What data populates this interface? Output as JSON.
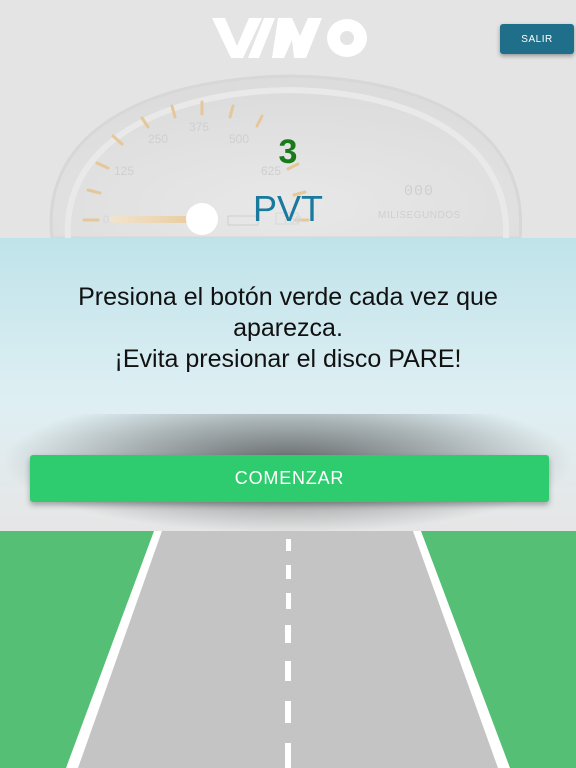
{
  "header": {
    "logo_text": "VIMO",
    "exit_label": "SALIR",
    "count": "3",
    "app_name": "PVT"
  },
  "gauge": {
    "scale_labels": [
      "0",
      "125",
      "250",
      "375",
      "500",
      "625",
      "750"
    ],
    "digital_value": "000",
    "unit_label": "MILISEGUNDOS"
  },
  "instructions": {
    "line1": "Presiona el botón verde cada vez que",
    "line2": "aparezca.",
    "line3": "¡Evita presionar el disco PARE!"
  },
  "start_label": "COMENZAR",
  "colors": {
    "start_button": "#2ecc6e",
    "exit_button": "#1f6f8b",
    "count_text": "#1a7a1a",
    "app_name_text": "#1a7a9e",
    "grass": "#55bf76",
    "road": "#c4c4c4"
  }
}
